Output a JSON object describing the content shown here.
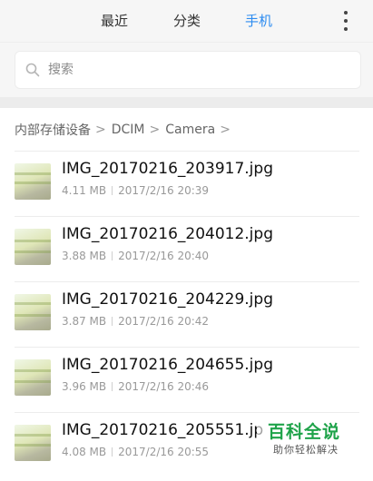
{
  "tabs": [
    {
      "label": "最近"
    },
    {
      "label": "分类"
    },
    {
      "label": "手机"
    }
  ],
  "active_tab_color": "#2d8cf0",
  "search": {
    "placeholder": "搜索"
  },
  "breadcrumb": [
    {
      "label": "内部存储设备"
    },
    {
      "label": "DCIM"
    },
    {
      "label": "Camera"
    }
  ],
  "files": [
    {
      "name": "IMG_20170216_203917.jpg",
      "size": "4.11 MB",
      "date": "2017/2/16 20:39"
    },
    {
      "name": "IMG_20170216_204012.jpg",
      "size": "3.88 MB",
      "date": "2017/2/16 20:40"
    },
    {
      "name": "IMG_20170216_204229.jpg",
      "size": "3.87 MB",
      "date": "2017/2/16 20:42"
    },
    {
      "name": "IMG_20170216_204655.jpg",
      "size": "3.96 MB",
      "date": "2017/2/16 20:46"
    },
    {
      "name": "IMG_20170216_205551.jp",
      "size": "4.08 MB",
      "date": "2017/2/16 20:55"
    }
  ],
  "watermark": {
    "title": "百科全说",
    "subtitle": "助你轻松解决"
  }
}
